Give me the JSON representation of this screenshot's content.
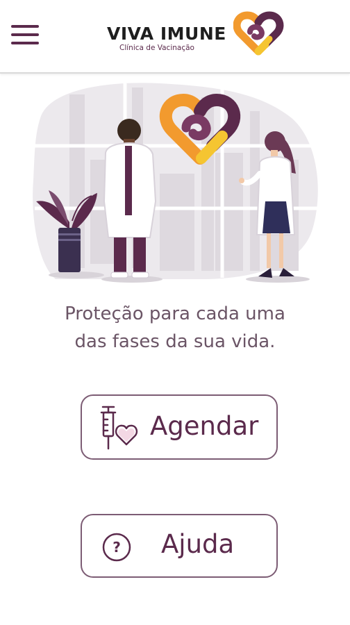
{
  "header": {
    "menu_icon": "hamburger-menu-icon",
    "brand_name": "VIVA IMUNE",
    "brand_subtitle": "Clínica de Vacinação",
    "brand_colors": {
      "orange": "#f29a2e",
      "purple": "#5b2a4c",
      "yellow": "#f5c531"
    }
  },
  "hero": {
    "illustration": "doctors-with-heart-logo-illustration"
  },
  "tagline": {
    "line1": "Proteção para cada uma",
    "line2": "das fases da sua vida."
  },
  "actions": {
    "schedule": {
      "label": "Agendar",
      "icon": "syringe-heart-icon"
    },
    "help": {
      "label": "Ajuda",
      "icon": "question-circle-icon"
    }
  },
  "colors": {
    "accent": "#5b2a4c",
    "text": "#6b5566",
    "border": "#7c5c74"
  }
}
